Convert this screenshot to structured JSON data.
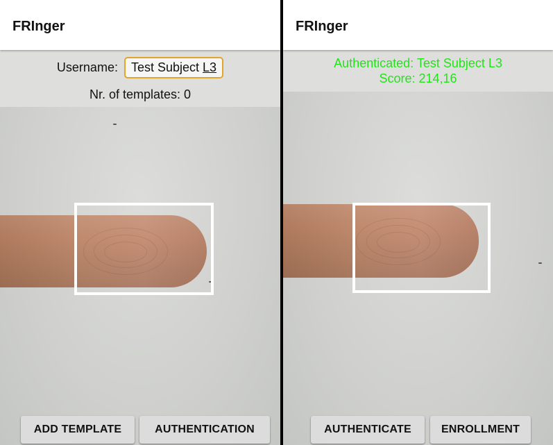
{
  "left_screen": {
    "app_title": "FRInger",
    "username_label": "Username:",
    "username_value_main": "Test Subject ",
    "username_value_suffix": "L3",
    "templates_text": "Nr. of templates: 0",
    "buttons": {
      "add_template": "ADD TEMPLATE",
      "authentication": "AUTHENTICATION"
    }
  },
  "right_screen": {
    "app_title": "FRInger",
    "auth_status": "Authenticated: Test Subject L3",
    "score_text": "Score: 214,16",
    "status_color": "#22e31a",
    "buttons": {
      "authenticate": "AUTHENTICATE",
      "enrollment": "ENROLLMENT"
    }
  },
  "colors": {
    "field_border": "#e0a52a",
    "roi_frame": "#ffffff",
    "appbar": "#ffffff",
    "divider": "#000000"
  }
}
